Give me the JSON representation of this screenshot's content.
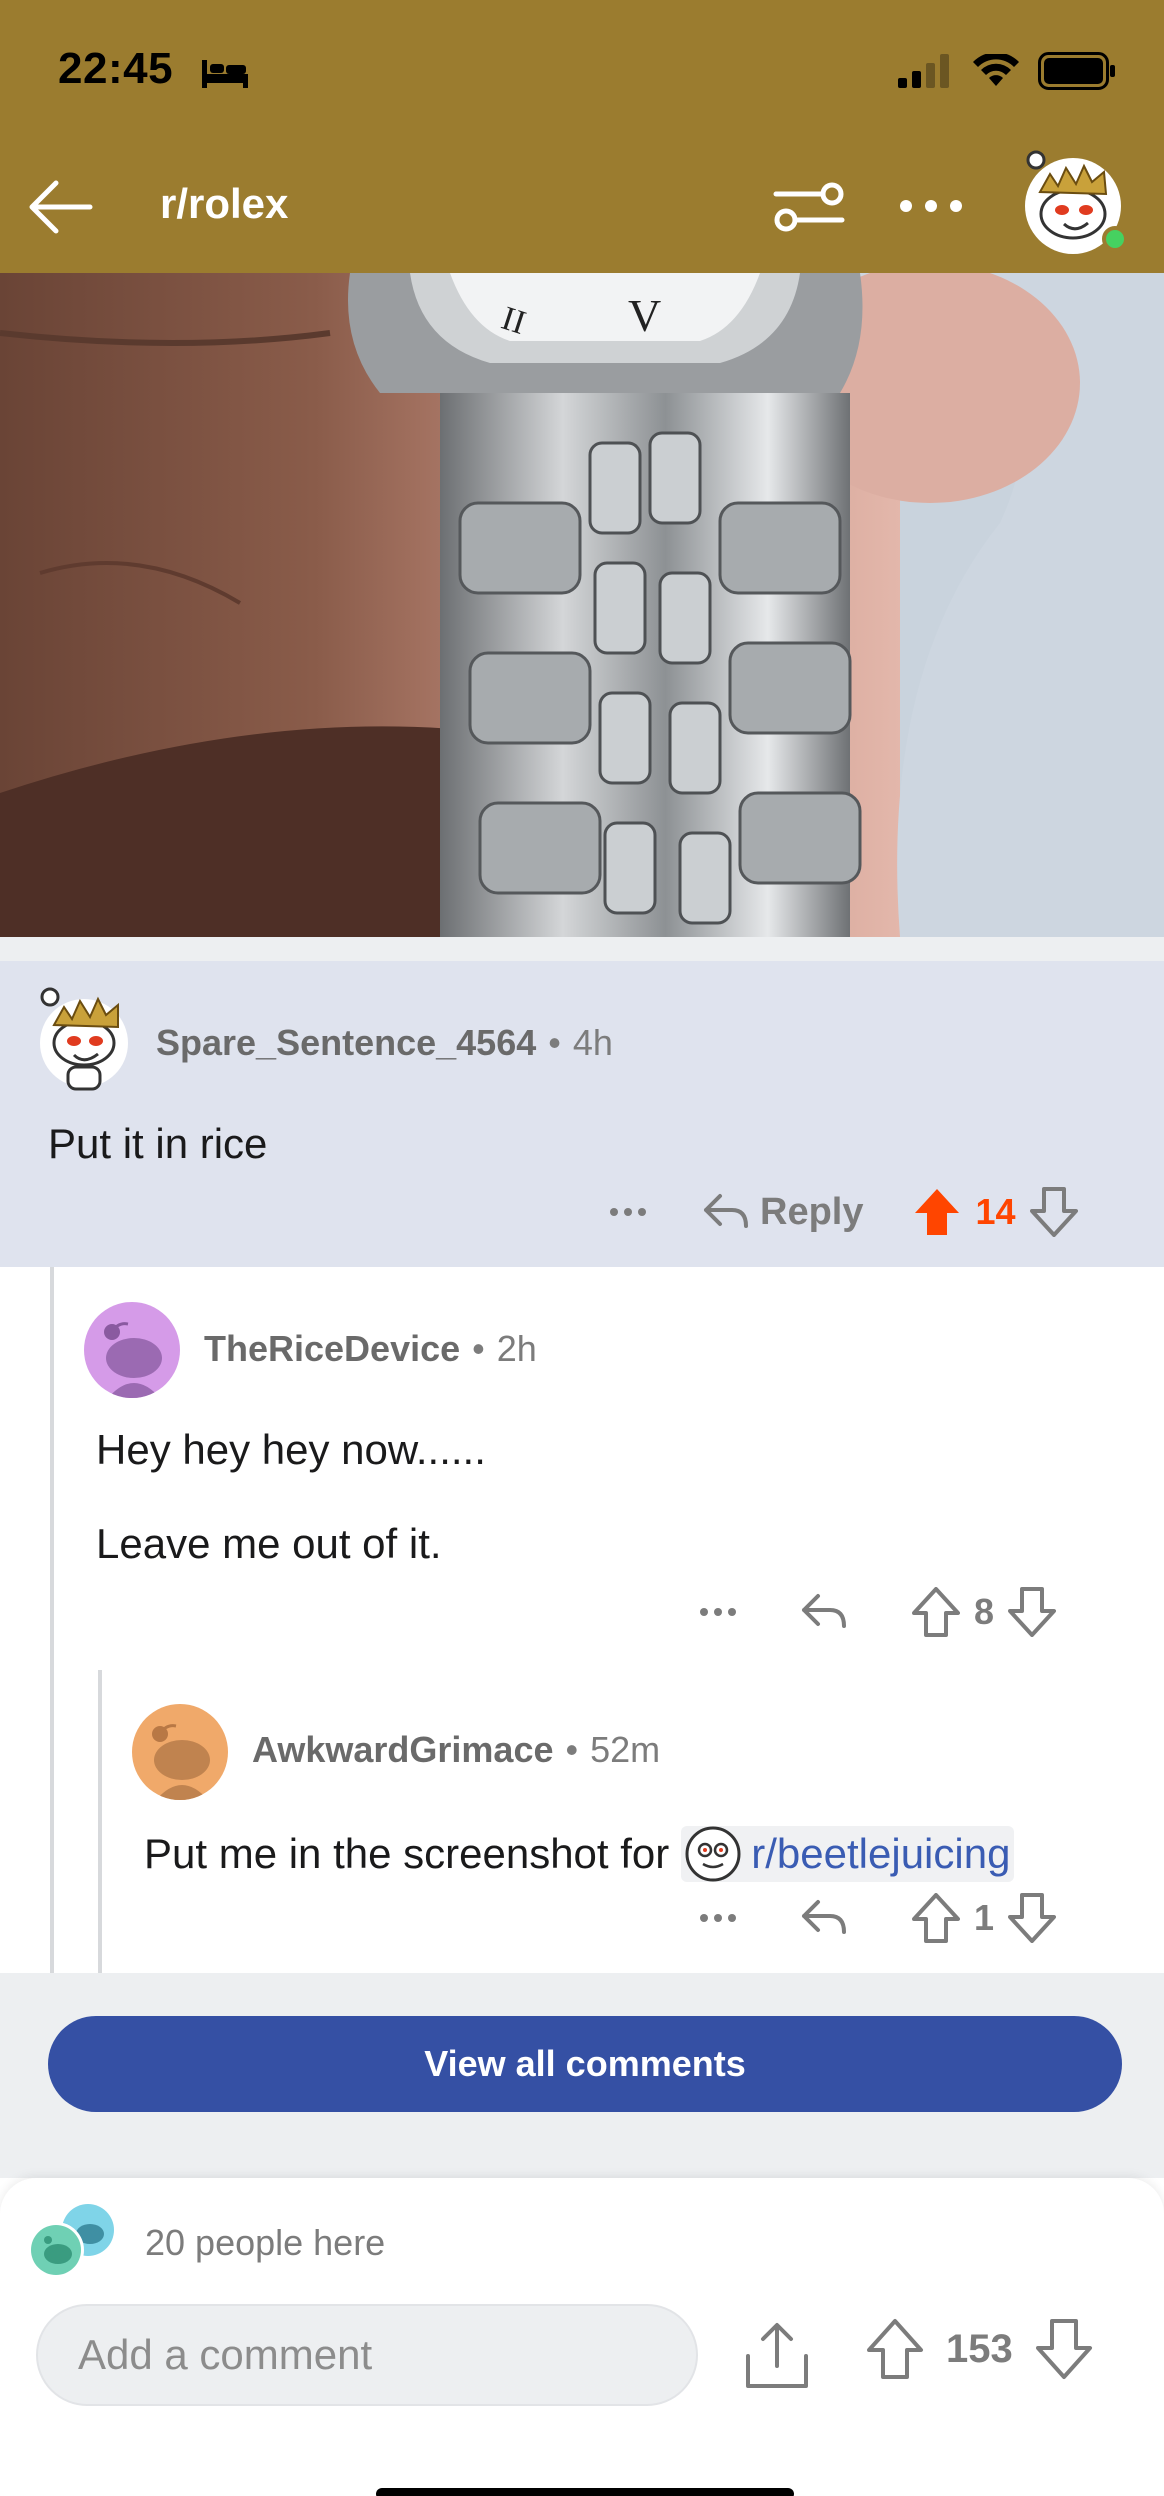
{
  "status_bar": {
    "time": "22:45"
  },
  "header": {
    "subreddit": "r/rolex",
    "icons": [
      "back-arrow-icon",
      "filter-icon",
      "more-icon",
      "user-avatar-icon"
    ]
  },
  "comments": [
    {
      "username": "Spare_Sentence_4564",
      "separator": "•",
      "age": "4h",
      "body": "Put it in rice",
      "reply_label": "Reply",
      "score": "14",
      "upvoted": true
    },
    {
      "username": "TheRiceDevice",
      "separator": "•",
      "age": "2h",
      "body_lines": [
        "Hey hey hey now......",
        "Leave me out of it."
      ],
      "score": "8"
    },
    {
      "username": "AwkwardGrimace",
      "separator": "•",
      "age": "52m",
      "body_prefix": "Put me in the screenshot for",
      "body_link": "r/beetlejuicing",
      "score": "1"
    }
  ],
  "view_all_label": "View all comments",
  "bottom": {
    "people_here": "20 people here",
    "comment_placeholder": "Add a comment",
    "post_score": "153"
  },
  "colors": {
    "header": "#9b7c2f",
    "upvote": "#ff4500",
    "button": "#3550a4",
    "highlight": "#dfe3ee"
  }
}
